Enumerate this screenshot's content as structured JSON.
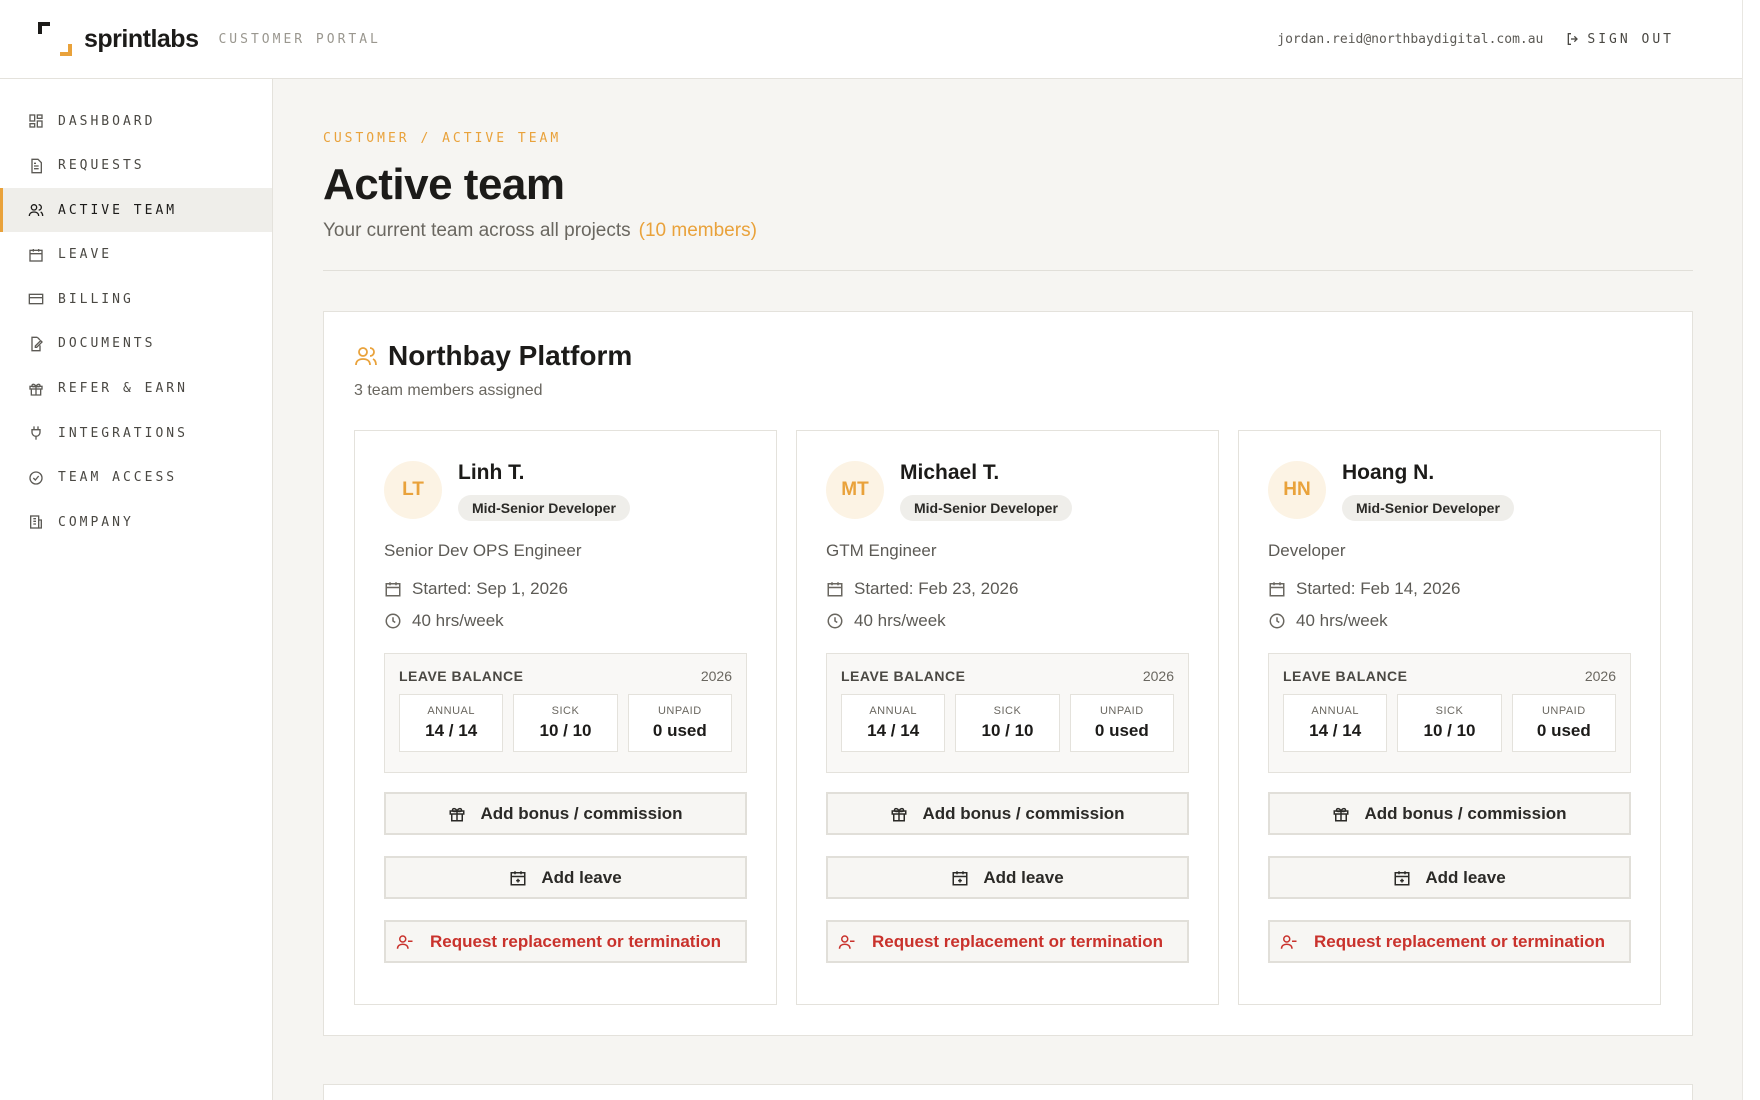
{
  "header": {
    "brand_name": "sprintlabs",
    "brand_subtitle": "CUSTOMER PORTAL",
    "user_email": "jordan.reid@northbaydigital.com.au",
    "signout_label": "SIGN OUT"
  },
  "sidebar": {
    "items": [
      {
        "label": "DASHBOARD",
        "icon": "dashboard-icon"
      },
      {
        "label": "REQUESTS",
        "icon": "document-icon"
      },
      {
        "label": "ACTIVE TEAM",
        "icon": "users-icon",
        "active": true
      },
      {
        "label": "LEAVE",
        "icon": "calendar-icon"
      },
      {
        "label": "BILLING",
        "icon": "credit-card-icon"
      },
      {
        "label": "DOCUMENTS",
        "icon": "document-edit-icon"
      },
      {
        "label": "REFER & EARN",
        "icon": "gift-icon"
      },
      {
        "label": "INTEGRATIONS",
        "icon": "plug-icon"
      },
      {
        "label": "TEAM ACCESS",
        "icon": "check-circle-icon"
      },
      {
        "label": "COMPANY",
        "icon": "building-icon"
      }
    ]
  },
  "page": {
    "breadcrumb": "CUSTOMER / ACTIVE TEAM",
    "title": "Active team",
    "subtitle": "Your current team across all projects",
    "member_count": "(10 members)"
  },
  "project": {
    "name": "Northbay Platform",
    "assigned": "3 team members assigned",
    "members": [
      {
        "initials": "LT",
        "name": "Linh T.",
        "level": "Mid-Senior Developer",
        "role": "Senior Dev OPS Engineer",
        "started": "Started: Sep 1, 2026",
        "hours": "40 hrs/week",
        "leave_title": "LEAVE BALANCE",
        "leave_year": "2026",
        "annual_label": "ANNUAL",
        "annual": "14 / 14",
        "sick_label": "SICK",
        "sick": "10 / 10",
        "unpaid_label": "UNPAID",
        "unpaid": "0 used",
        "bonus_label": "Add bonus / commission",
        "leave_label": "Add leave",
        "replace_label": "Request replacement or termination"
      },
      {
        "initials": "MT",
        "name": "Michael T.",
        "level": "Mid-Senior Developer",
        "role": "GTM Engineer",
        "started": "Started: Feb 23, 2026",
        "hours": "40 hrs/week",
        "leave_title": "LEAVE BALANCE",
        "leave_year": "2026",
        "annual_label": "ANNUAL",
        "annual": "14 / 14",
        "sick_label": "SICK",
        "sick": "10 / 10",
        "unpaid_label": "UNPAID",
        "unpaid": "0 used",
        "bonus_label": "Add bonus / commission",
        "leave_label": "Add leave",
        "replace_label": "Request replacement or termination"
      },
      {
        "initials": "HN",
        "name": "Hoang N.",
        "level": "Mid-Senior Developer",
        "role": "Developer",
        "started": "Started: Feb 14, 2026",
        "hours": "40 hrs/week",
        "leave_title": "LEAVE BALANCE",
        "leave_year": "2026",
        "annual_label": "ANNUAL",
        "annual": "14 / 14",
        "sick_label": "SICK",
        "sick": "10 / 10",
        "unpaid_label": "UNPAID",
        "unpaid": "0 used",
        "bonus_label": "Add bonus / commission",
        "leave_label": "Add leave",
        "replace_label": "Request replacement or termination"
      }
    ]
  },
  "colors": {
    "accent": "#e9a23b",
    "danger": "#c9322c",
    "background": "#f6f5f2"
  }
}
